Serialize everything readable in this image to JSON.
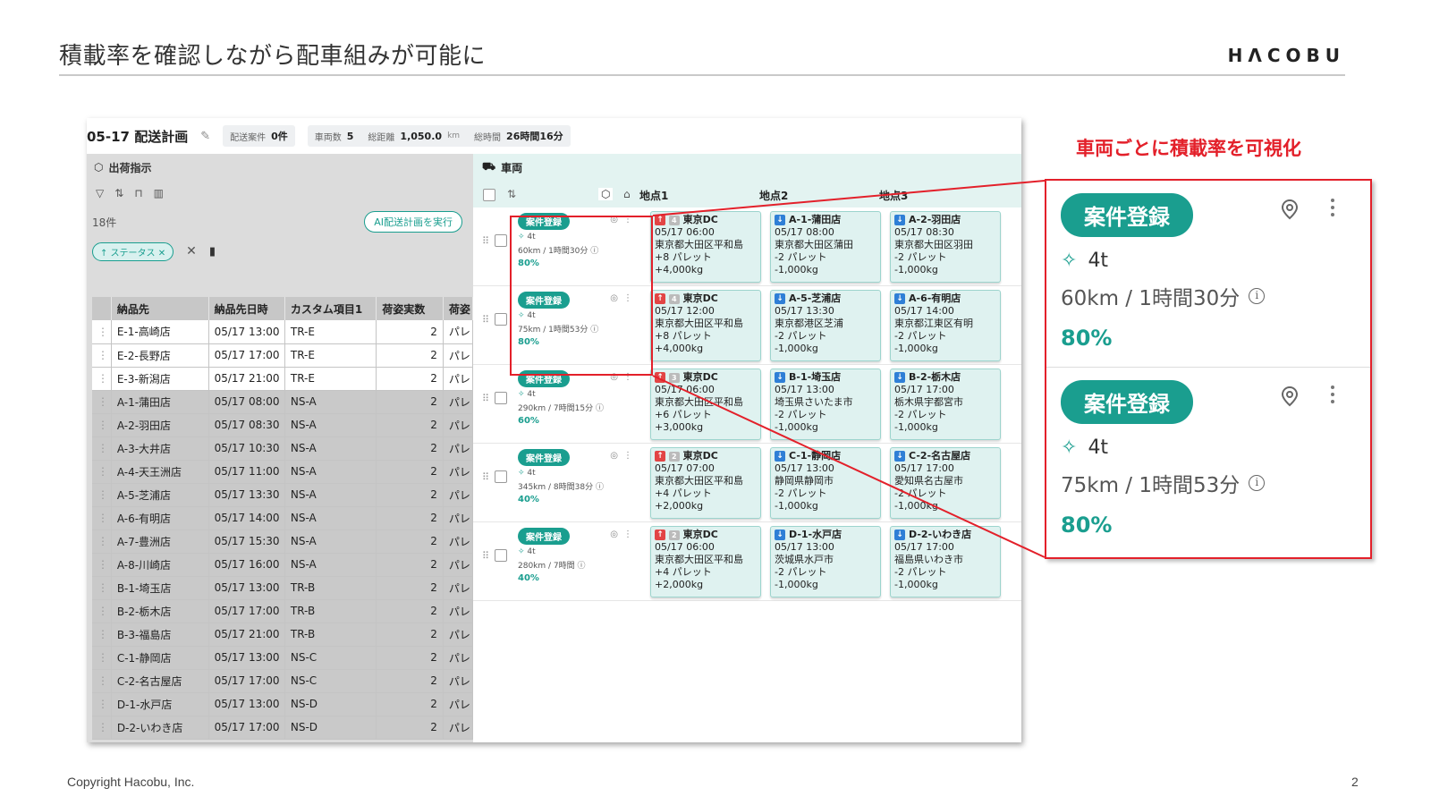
{
  "slide": {
    "title": "積載率を確認しながら配車組みが可能に",
    "logo": "HΛCOBU",
    "copyright": "Copyright Hacobu, Inc.",
    "page_number": "2",
    "callout_title": "車両ごとに積載率を可視化",
    "accent_color": "#1a9e8f",
    "highlight_color": "#e3202a"
  },
  "header": {
    "plan_title": "05-17 配送計画",
    "chips": [
      {
        "label": "配送案件",
        "value": "0件",
        "unit": ""
      },
      {
        "label": "車両数",
        "value": "5",
        "unit": ""
      },
      {
        "label": "総距離",
        "value": "1,050.0",
        "unit": "km"
      },
      {
        "label": "総時間",
        "value": "26時間16分",
        "unit": ""
      }
    ]
  },
  "left_panel": {
    "title": "出荷指示",
    "count": "18件",
    "ai_button": "AI配送計画を実行",
    "status_chip": "↑ ステータス ✕",
    "columns": [
      "納品先",
      "納品先日時",
      "カスタム項目1",
      "荷姿実数",
      "荷姿"
    ],
    "rows": [
      {
        "name": "E-1-高崎店",
        "time": "05/17 13:00",
        "custom": "TR-E",
        "qty": "2",
        "pack": "パレ",
        "shade": "white"
      },
      {
        "name": "E-2-長野店",
        "time": "05/17 17:00",
        "custom": "TR-E",
        "qty": "2",
        "pack": "パレ",
        "shade": "white"
      },
      {
        "name": "E-3-新潟店",
        "time": "05/17 21:00",
        "custom": "TR-E",
        "qty": "2",
        "pack": "パレ",
        "shade": "white"
      },
      {
        "name": "A-1-蒲田店",
        "time": "05/17 08:00",
        "custom": "NS-A",
        "qty": "2",
        "pack": "パレ",
        "shade": "gray"
      },
      {
        "name": "A-2-羽田店",
        "time": "05/17 08:30",
        "custom": "NS-A",
        "qty": "2",
        "pack": "パレ",
        "shade": "gray"
      },
      {
        "name": "A-3-大井店",
        "time": "05/17 10:30",
        "custom": "NS-A",
        "qty": "2",
        "pack": "パレ",
        "shade": "gray"
      },
      {
        "name": "A-4-天王洲店",
        "time": "05/17 11:00",
        "custom": "NS-A",
        "qty": "2",
        "pack": "パレ",
        "shade": "gray"
      },
      {
        "name": "A-5-芝浦店",
        "time": "05/17 13:30",
        "custom": "NS-A",
        "qty": "2",
        "pack": "パレ",
        "shade": "gray"
      },
      {
        "name": "A-6-有明店",
        "time": "05/17 14:00",
        "custom": "NS-A",
        "qty": "2",
        "pack": "パレ",
        "shade": "gray"
      },
      {
        "name": "A-7-豊洲店",
        "time": "05/17 15:30",
        "custom": "NS-A",
        "qty": "2",
        "pack": "パレ",
        "shade": "gray"
      },
      {
        "name": "A-8-川崎店",
        "time": "05/17 16:00",
        "custom": "NS-A",
        "qty": "2",
        "pack": "パレ",
        "shade": "gray"
      },
      {
        "name": "B-1-埼玉店",
        "time": "05/17 13:00",
        "custom": "TR-B",
        "qty": "2",
        "pack": "パレ",
        "shade": "gray"
      },
      {
        "name": "B-2-栃木店",
        "time": "05/17 17:00",
        "custom": "TR-B",
        "qty": "2",
        "pack": "パレ",
        "shade": "gray"
      },
      {
        "name": "B-3-福島店",
        "time": "05/17 21:00",
        "custom": "TR-B",
        "qty": "2",
        "pack": "パレ",
        "shade": "gray"
      },
      {
        "name": "C-1-静岡店",
        "time": "05/17 13:00",
        "custom": "NS-C",
        "qty": "2",
        "pack": "パレ",
        "shade": "gray"
      },
      {
        "name": "C-2-名古屋店",
        "time": "05/17 17:00",
        "custom": "NS-C",
        "qty": "2",
        "pack": "パレ",
        "shade": "gray"
      },
      {
        "name": "D-1-水戸店",
        "time": "05/17 13:00",
        "custom": "NS-D",
        "qty": "2",
        "pack": "パレ",
        "shade": "gray"
      },
      {
        "name": "D-2-いわき店",
        "time": "05/17 17:00",
        "custom": "NS-D",
        "qty": "2",
        "pack": "パレ",
        "shade": "gray"
      }
    ]
  },
  "right_panel": {
    "title": "車両",
    "col_labels": [
      "地点1",
      "地点2",
      "地点3"
    ],
    "vehicles": [
      {
        "tag": "案件登録",
        "size": "4t",
        "distance": "60km / 1時間30分",
        "load": "80%",
        "stops": [
          {
            "dir": "up",
            "seq": "4",
            "name": "東京DC",
            "time": "05/17 06:00",
            "addr": "東京都大田区平和島",
            "pallet": "+8 パレット",
            "weight": "+4,000kg"
          },
          {
            "dir": "down",
            "seq": "",
            "name": "A-1-蒲田店",
            "time": "05/17 08:00",
            "addr": "東京都大田区蒲田",
            "pallet": "-2 パレット",
            "weight": "-1,000kg"
          },
          {
            "dir": "down",
            "seq": "",
            "name": "A-2-羽田店",
            "time": "05/17 08:30",
            "addr": "東京都大田区羽田",
            "pallet": "-2 パレット",
            "weight": "-1,000kg"
          }
        ]
      },
      {
        "tag": "案件登録",
        "size": "4t",
        "distance": "75km / 1時間53分",
        "load": "80%",
        "stops": [
          {
            "dir": "up",
            "seq": "4",
            "name": "東京DC",
            "time": "05/17 12:00",
            "addr": "東京都大田区平和島",
            "pallet": "+8 パレット",
            "weight": "+4,000kg"
          },
          {
            "dir": "down",
            "seq": "",
            "name": "A-5-芝浦店",
            "time": "05/17 13:30",
            "addr": "東京都港区芝浦",
            "pallet": "-2 パレット",
            "weight": "-1,000kg"
          },
          {
            "dir": "down",
            "seq": "",
            "name": "A-6-有明店",
            "time": "05/17 14:00",
            "addr": "東京都江東区有明",
            "pallet": "-2 パレット",
            "weight": "-1,000kg"
          }
        ]
      },
      {
        "tag": "案件登録",
        "size": "4t",
        "distance": "290km / 7時間15分",
        "load": "60%",
        "stops": [
          {
            "dir": "up",
            "seq": "3",
            "name": "東京DC",
            "time": "05/17 06:00",
            "addr": "東京都大田区平和島",
            "pallet": "+6 パレット",
            "weight": "+3,000kg"
          },
          {
            "dir": "down",
            "seq": "",
            "name": "B-1-埼玉店",
            "time": "05/17 13:00",
            "addr": "埼玉県さいたま市",
            "pallet": "-2 パレット",
            "weight": "-1,000kg"
          },
          {
            "dir": "down",
            "seq": "",
            "name": "B-2-栃木店",
            "time": "05/17 17:00",
            "addr": "栃木県宇都宮市",
            "pallet": "-2 パレット",
            "weight": "-1,000kg"
          }
        ]
      },
      {
        "tag": "案件登録",
        "size": "4t",
        "distance": "345km / 8時間38分",
        "load": "40%",
        "stops": [
          {
            "dir": "up",
            "seq": "2",
            "name": "東京DC",
            "time": "05/17 07:00",
            "addr": "東京都大田区平和島",
            "pallet": "+4 パレット",
            "weight": "+2,000kg"
          },
          {
            "dir": "down",
            "seq": "",
            "name": "C-1-静岡店",
            "time": "05/17 13:00",
            "addr": "静岡県静岡市",
            "pallet": "-2 パレット",
            "weight": "-1,000kg"
          },
          {
            "dir": "down",
            "seq": "",
            "name": "C-2-名古屋店",
            "time": "05/17 17:00",
            "addr": "愛知県名古屋市",
            "pallet": "-2 パレット",
            "weight": "-1,000kg"
          }
        ]
      },
      {
        "tag": "案件登録",
        "size": "4t",
        "distance": "280km / 7時間",
        "load": "40%",
        "stops": [
          {
            "dir": "up",
            "seq": "2",
            "name": "東京DC",
            "time": "05/17 06:00",
            "addr": "東京都大田区平和島",
            "pallet": "+4 パレット",
            "weight": "+2,000kg"
          },
          {
            "dir": "down",
            "seq": "",
            "name": "D-1-水戸店",
            "time": "05/17 13:00",
            "addr": "茨城県水戸市",
            "pallet": "-2 パレット",
            "weight": "-1,000kg"
          },
          {
            "dir": "down",
            "seq": "",
            "name": "D-2-いわき店",
            "time": "05/17 17:00",
            "addr": "福島県いわき市",
            "pallet": "-2 パレット",
            "weight": "-1,000kg"
          }
        ]
      }
    ]
  },
  "zoom": {
    "blocks": [
      {
        "tag": "案件登録",
        "size": "4t",
        "distance": "60km / 1時間30分",
        "load": "80%"
      },
      {
        "tag": "案件登録",
        "size": "4t",
        "distance": "75km / 1時間53分",
        "load": "80%"
      }
    ]
  }
}
